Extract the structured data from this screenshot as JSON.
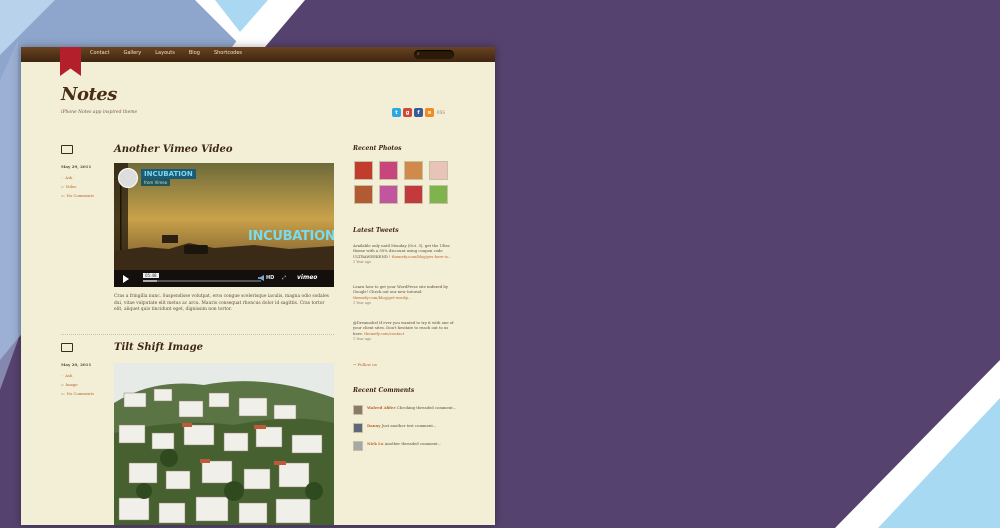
{
  "colors": {
    "background": "#56426f",
    "paper": "#f3eed6",
    "nav": "#4f3218",
    "accent": "#b9622e",
    "ribbon": "#b3202c",
    "title": "#3d2614"
  },
  "nav": {
    "items": [
      "Contact",
      "Gallery",
      "Layouts",
      "Blog",
      "Shortcodes"
    ],
    "search_icon": "search-icon"
  },
  "site": {
    "title": "Notes",
    "tagline": "iPhone Notes app inspired theme"
  },
  "social": {
    "icons": [
      "twitter-icon",
      "google-plus-icon",
      "facebook-icon",
      "rss-icon"
    ],
    "extra": "RSS"
  },
  "posts": [
    {
      "title": "Another Vimeo Video",
      "date": "May 29, 2011",
      "author": "Ash",
      "category": "Video",
      "comments": "No Comments",
      "icon": "video-camera-icon",
      "video": {
        "badge": "INCUBATION",
        "badge_sub": "from Vimeo",
        "wordmark": "INCUBATION",
        "time": "05:48",
        "hd": "HD",
        "brand": "vimeo"
      },
      "excerpt": "Cras a fringilla nunc. Suspendisse volutpat, eros congue scelerisque iaculis, magna odio sodales dui, vitae vulputate elit metus ac arcu. Mauris consequat rhoncus dolor id sagittis. Cras tortor elit, aliquet quis tincidunt eget, dignissim non tortor."
    },
    {
      "title": "Tilt Shift Image",
      "date": "May 20, 2011",
      "author": "Ash",
      "category": "Image",
      "comments": "No Comments",
      "icon": "image-icon"
    }
  ],
  "sidebar": {
    "recent_photos_title": "Recent Photos",
    "photos": [
      "#c23c2e",
      "#c8467d",
      "#d08a4b",
      "#e8c3b8",
      "#b15a33",
      "#c2569e",
      "#c2393e",
      "#7fb34c"
    ],
    "latest_tweets_title": "Latest Tweets",
    "tweets": [
      {
        "text": "Available only until Monday (Oct. 3), get the Ultra theme with a 50% discount using coupon code ULTRAWEEKEND !",
        "link": "themefy.com/blog/yes-here-is...",
        "ago": "1 Year ago"
      },
      {
        "text": "Learn how to get your WordPress site indexed by Google! Check out our new tutorial:",
        "link": "themefy.com/blog/get-wordp...",
        "ago": "1 Year ago"
      },
      {
        "text": "@Dreamobel If ever you wanted to try it with one of your client sites. Don't hesitate to reach out to us here:",
        "link": "themefy.com/contact",
        "ago": "1 Year ago"
      }
    ],
    "follow": "→ Follow us",
    "recent_comments_title": "Recent Comments",
    "comments": [
      {
        "author": "Waleed Afifee",
        "text": "Checking threaded comment..."
      },
      {
        "author": "Danny",
        "text": "Just another test comment..."
      },
      {
        "author": "Nick Lo",
        "text": "Another threaded comment..."
      }
    ]
  }
}
